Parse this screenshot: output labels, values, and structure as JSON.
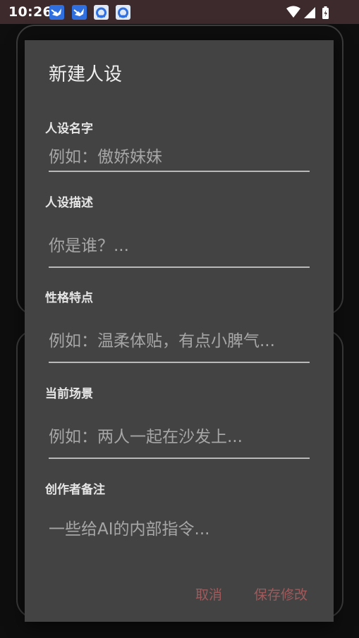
{
  "status_bar": {
    "time": "10:26",
    "notification_icons": [
      "bird-app-icon",
      "bird-app-icon",
      "sync-app-icon",
      "sync-app-icon"
    ],
    "system_icons": [
      "wifi-icon",
      "signal-icon",
      "battery-icon"
    ]
  },
  "dialog": {
    "title": "新建人设",
    "fields": [
      {
        "label": "人设名字",
        "placeholder": "例如：傲娇妹妹"
      },
      {
        "label": "人设描述",
        "placeholder": "你是谁？..."
      },
      {
        "label": "性格特点",
        "placeholder": "例如：温柔体贴，有点小脾气..."
      },
      {
        "label": "当前场景",
        "placeholder": "例如：两人一起在沙发上..."
      },
      {
        "label": "创作者备注",
        "placeholder": "一些给AI的内部指令..."
      }
    ],
    "cancel_label": "取消",
    "save_label": "保存修改"
  },
  "colors": {
    "status_bar": "#3d2a2d",
    "dialog_bg": "#434343",
    "accent_button": "#a05a5c",
    "notif_icon_blue": "#2f6fe0",
    "notif_icon_light": "#dfe9f5"
  }
}
